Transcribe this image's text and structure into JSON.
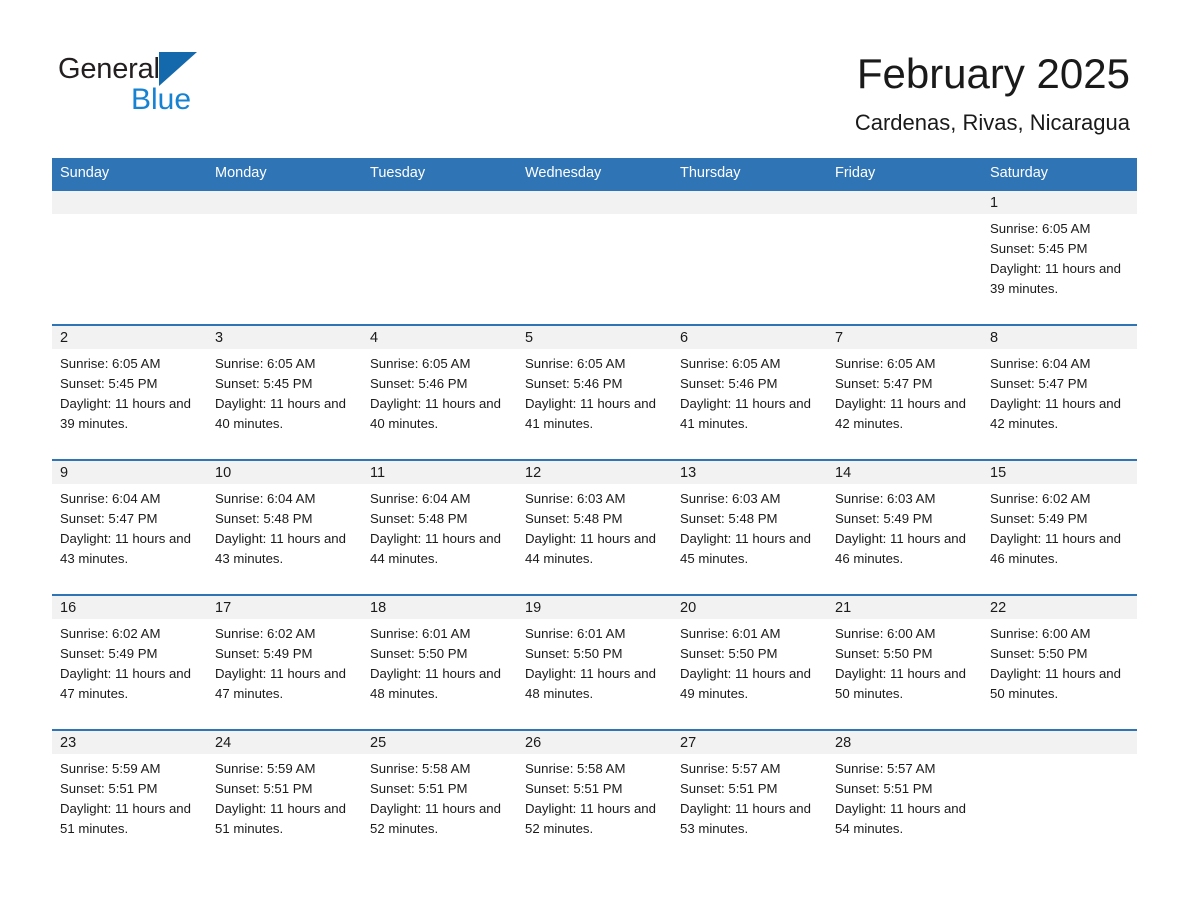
{
  "brand": {
    "name_part1": "General",
    "name_part2": "Blue",
    "triangle_color": "#1369ab",
    "blue_color": "#1683d2"
  },
  "header": {
    "month_title": "February 2025",
    "location": "Cardenas, Rivas, Nicaragua"
  },
  "theme": {
    "header_row_bg": "#2f74b5",
    "day_band_bg": "#f2f2f2",
    "cell_border_top": "#2f74b5",
    "text_color": "#1a1a1a"
  },
  "weekday_headers": [
    "Sunday",
    "Monday",
    "Tuesday",
    "Wednesday",
    "Thursday",
    "Friday",
    "Saturday"
  ],
  "labels": {
    "sunrise_prefix": "Sunrise:",
    "sunset_prefix": "Sunset:",
    "daylight_prefix": "Daylight:"
  },
  "weeks": [
    [
      {
        "blank": true
      },
      {
        "blank": true
      },
      {
        "blank": true
      },
      {
        "blank": true
      },
      {
        "blank": true
      },
      {
        "blank": true
      },
      {
        "day": "1",
        "sunrise": "Sunrise: 6:05 AM",
        "sunset": "Sunset: 5:45 PM",
        "daylight": "Daylight: 11 hours and 39 minutes."
      }
    ],
    [
      {
        "day": "2",
        "sunrise": "Sunrise: 6:05 AM",
        "sunset": "Sunset: 5:45 PM",
        "daylight": "Daylight: 11 hours and 39 minutes."
      },
      {
        "day": "3",
        "sunrise": "Sunrise: 6:05 AM",
        "sunset": "Sunset: 5:45 PM",
        "daylight": "Daylight: 11 hours and 40 minutes."
      },
      {
        "day": "4",
        "sunrise": "Sunrise: 6:05 AM",
        "sunset": "Sunset: 5:46 PM",
        "daylight": "Daylight: 11 hours and 40 minutes."
      },
      {
        "day": "5",
        "sunrise": "Sunrise: 6:05 AM",
        "sunset": "Sunset: 5:46 PM",
        "daylight": "Daylight: 11 hours and 41 minutes."
      },
      {
        "day": "6",
        "sunrise": "Sunrise: 6:05 AM",
        "sunset": "Sunset: 5:46 PM",
        "daylight": "Daylight: 11 hours and 41 minutes."
      },
      {
        "day": "7",
        "sunrise": "Sunrise: 6:05 AM",
        "sunset": "Sunset: 5:47 PM",
        "daylight": "Daylight: 11 hours and 42 minutes."
      },
      {
        "day": "8",
        "sunrise": "Sunrise: 6:04 AM",
        "sunset": "Sunset: 5:47 PM",
        "daylight": "Daylight: 11 hours and 42 minutes."
      }
    ],
    [
      {
        "day": "9",
        "sunrise": "Sunrise: 6:04 AM",
        "sunset": "Sunset: 5:47 PM",
        "daylight": "Daylight: 11 hours and 43 minutes."
      },
      {
        "day": "10",
        "sunrise": "Sunrise: 6:04 AM",
        "sunset": "Sunset: 5:48 PM",
        "daylight": "Daylight: 11 hours and 43 minutes."
      },
      {
        "day": "11",
        "sunrise": "Sunrise: 6:04 AM",
        "sunset": "Sunset: 5:48 PM",
        "daylight": "Daylight: 11 hours and 44 minutes."
      },
      {
        "day": "12",
        "sunrise": "Sunrise: 6:03 AM",
        "sunset": "Sunset: 5:48 PM",
        "daylight": "Daylight: 11 hours and 44 minutes."
      },
      {
        "day": "13",
        "sunrise": "Sunrise: 6:03 AM",
        "sunset": "Sunset: 5:48 PM",
        "daylight": "Daylight: 11 hours and 45 minutes."
      },
      {
        "day": "14",
        "sunrise": "Sunrise: 6:03 AM",
        "sunset": "Sunset: 5:49 PM",
        "daylight": "Daylight: 11 hours and 46 minutes."
      },
      {
        "day": "15",
        "sunrise": "Sunrise: 6:02 AM",
        "sunset": "Sunset: 5:49 PM",
        "daylight": "Daylight: 11 hours and 46 minutes."
      }
    ],
    [
      {
        "day": "16",
        "sunrise": "Sunrise: 6:02 AM",
        "sunset": "Sunset: 5:49 PM",
        "daylight": "Daylight: 11 hours and 47 minutes."
      },
      {
        "day": "17",
        "sunrise": "Sunrise: 6:02 AM",
        "sunset": "Sunset: 5:49 PM",
        "daylight": "Daylight: 11 hours and 47 minutes."
      },
      {
        "day": "18",
        "sunrise": "Sunrise: 6:01 AM",
        "sunset": "Sunset: 5:50 PM",
        "daylight": "Daylight: 11 hours and 48 minutes."
      },
      {
        "day": "19",
        "sunrise": "Sunrise: 6:01 AM",
        "sunset": "Sunset: 5:50 PM",
        "daylight": "Daylight: 11 hours and 48 minutes."
      },
      {
        "day": "20",
        "sunrise": "Sunrise: 6:01 AM",
        "sunset": "Sunset: 5:50 PM",
        "daylight": "Daylight: 11 hours and 49 minutes."
      },
      {
        "day": "21",
        "sunrise": "Sunrise: 6:00 AM",
        "sunset": "Sunset: 5:50 PM",
        "daylight": "Daylight: 11 hours and 50 minutes."
      },
      {
        "day": "22",
        "sunrise": "Sunrise: 6:00 AM",
        "sunset": "Sunset: 5:50 PM",
        "daylight": "Daylight: 11 hours and 50 minutes."
      }
    ],
    [
      {
        "day": "23",
        "sunrise": "Sunrise: 5:59 AM",
        "sunset": "Sunset: 5:51 PM",
        "daylight": "Daylight: 11 hours and 51 minutes."
      },
      {
        "day": "24",
        "sunrise": "Sunrise: 5:59 AM",
        "sunset": "Sunset: 5:51 PM",
        "daylight": "Daylight: 11 hours and 51 minutes."
      },
      {
        "day": "25",
        "sunrise": "Sunrise: 5:58 AM",
        "sunset": "Sunset: 5:51 PM",
        "daylight": "Daylight: 11 hours and 52 minutes."
      },
      {
        "day": "26",
        "sunrise": "Sunrise: 5:58 AM",
        "sunset": "Sunset: 5:51 PM",
        "daylight": "Daylight: 11 hours and 52 minutes."
      },
      {
        "day": "27",
        "sunrise": "Sunrise: 5:57 AM",
        "sunset": "Sunset: 5:51 PM",
        "daylight": "Daylight: 11 hours and 53 minutes."
      },
      {
        "day": "28",
        "sunrise": "Sunrise: 5:57 AM",
        "sunset": "Sunset: 5:51 PM",
        "daylight": "Daylight: 11 hours and 54 minutes."
      },
      {
        "blank": true
      }
    ]
  ]
}
